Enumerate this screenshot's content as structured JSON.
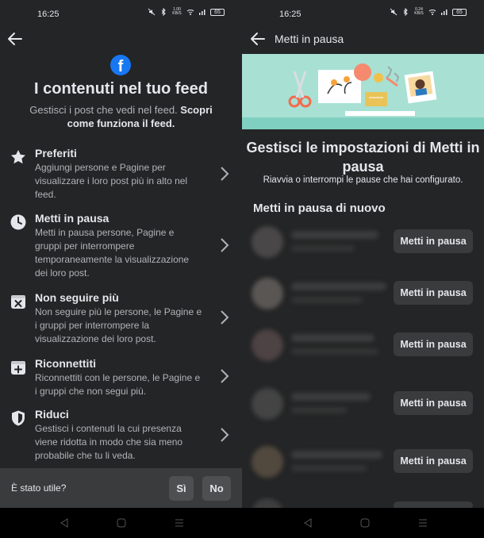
{
  "status": {
    "time": "16:25",
    "battery": "65",
    "net_left": "1.00 KB/S",
    "net_right": "0.24 KB/S"
  },
  "left": {
    "title": "I contenuti nel tuo feed",
    "subtitle": "Gestisci i post che vedi nel feed. ",
    "subtitle_link": "Scopri come funziona il feed.",
    "items": [
      {
        "title": "Preferiti",
        "desc": "Aggiungi persone e Pagine per visualizzare i loro post più in alto nel feed.",
        "icon": "star-icon"
      },
      {
        "title": "Metti in pausa",
        "desc": "Metti in pausa persone, Pagine e gruppi per interrompere temporaneamente la visualizzazione dei loro post.",
        "icon": "clock-icon"
      },
      {
        "title": "Non seguire più",
        "desc": "Non seguire più le persone, le Pagine e i gruppi per interrompere la visualizzazione dei loro post.",
        "icon": "unfollow-icon"
      },
      {
        "title": "Riconnettiti",
        "desc": "Riconnettiti con le persone, le Pagine e i gruppi che non segui più.",
        "icon": "reconnect-icon"
      },
      {
        "title": "Riduci",
        "desc": "Gestisci i contenuti la cui presenza viene ridotta in modo che sia meno probabile che tu li veda.",
        "icon": "shield-icon"
      }
    ],
    "feedback": {
      "question": "È stato utile?",
      "yes": "Sì",
      "no": "No"
    }
  },
  "right": {
    "header_title": "Metti in pausa",
    "title": "Gestisci le impostazioni di Metti in pausa",
    "subtitle": "Riavvia o interrompi le pause che hai configurato.",
    "section_title": "Metti in pausa di nuovo",
    "rows": [
      {
        "button": "Metti in pausa"
      },
      {
        "button": "Metti in pausa"
      },
      {
        "button": "Metti in pausa"
      },
      {
        "button": "Metti in pausa"
      },
      {
        "button": "Metti in pausa"
      }
    ]
  },
  "colors": {
    "bg": "#242526",
    "accent": "#1877f2",
    "banner": "#a8e0d4",
    "button": "#3a3b3c"
  }
}
